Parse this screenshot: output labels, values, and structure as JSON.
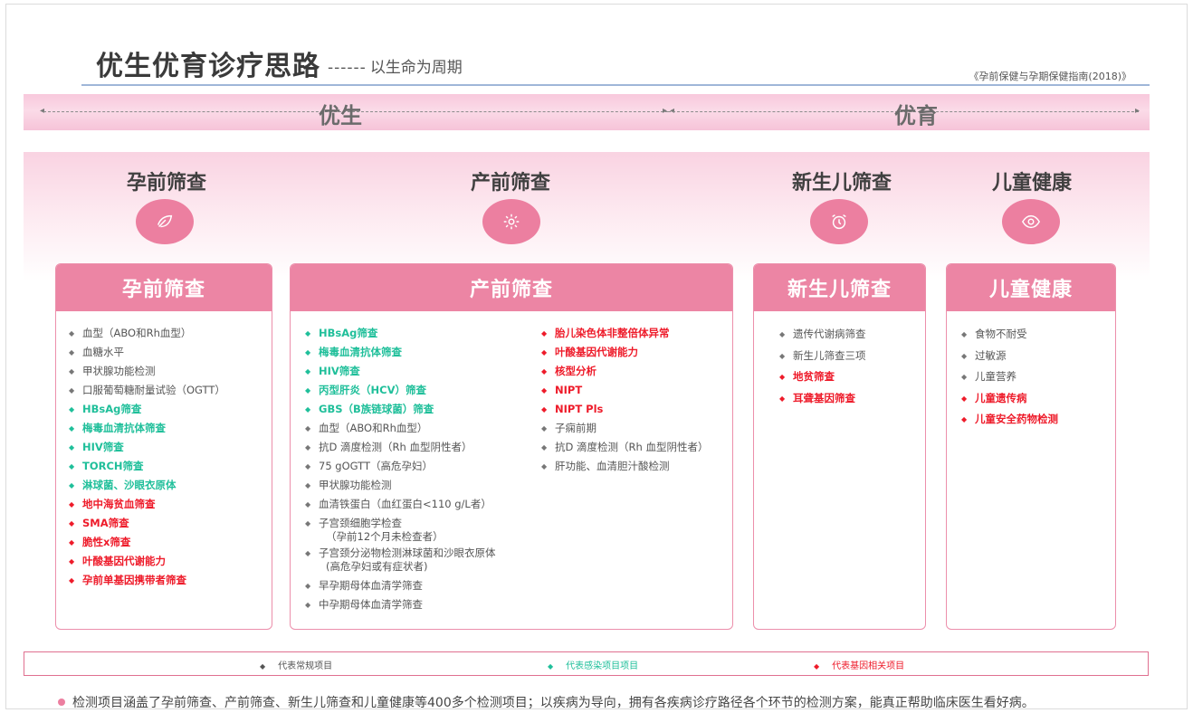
{
  "header": {
    "title": "优生优育诊疗思路",
    "subtitle_dash": "------",
    "subtitle": "以生命为周期",
    "source": "《孕前保健与孕期保健指南(2018)》"
  },
  "band": {
    "left_label": "优生",
    "right_label": "优育"
  },
  "categories": [
    {
      "title": "孕前筛查",
      "icon": "leaf-icon"
    },
    {
      "title": "产前筛查",
      "icon": "gear-icon"
    },
    {
      "title": "新生儿筛查",
      "icon": "alarm-clock-icon"
    },
    {
      "title": "儿童健康",
      "icon": "eye-icon"
    }
  ],
  "cards": {
    "preconception": {
      "title": "孕前筛查",
      "items": [
        {
          "text": "血型（ABO和Rh血型）",
          "type": "normal"
        },
        {
          "text": "血糖水平",
          "type": "normal"
        },
        {
          "text": "甲状腺功能检测",
          "type": "normal"
        },
        {
          "text": "口服葡萄糖耐量试验（OGTT）",
          "type": "normal"
        },
        {
          "text": "HBsAg筛查",
          "type": "infection"
        },
        {
          "text": "梅毒血清抗体筛查",
          "type": "infection"
        },
        {
          "text": "HIV筛查",
          "type": "infection"
        },
        {
          "text": "TORCH筛查",
          "type": "infection"
        },
        {
          "text": "淋球菌、沙眼衣原体",
          "type": "infection"
        },
        {
          "text": "地中海贫血筛查",
          "type": "gene"
        },
        {
          "text": "SMA筛查",
          "type": "gene"
        },
        {
          "text": "脆性x筛查",
          "type": "gene"
        },
        {
          "text": "叶酸基因代谢能力",
          "type": "gene"
        },
        {
          "text": "孕前单基因携带者筛查",
          "type": "gene"
        }
      ]
    },
    "prenatal": {
      "title": "产前筛查",
      "left_items": [
        {
          "text": "HBsAg筛查",
          "type": "infection"
        },
        {
          "text": "梅毒血清抗体筛查",
          "type": "infection"
        },
        {
          "text": "HIV筛查",
          "type": "infection"
        },
        {
          "text": "丙型肝炎（HCV）筛查",
          "type": "infection"
        },
        {
          "text": "GBS（B族链球菌）筛查",
          "type": "infection"
        },
        {
          "text": "血型（ABO和Rh血型）",
          "type": "normal"
        },
        {
          "text": "抗D 滴度检测（Rh 血型阴性者）",
          "type": "normal"
        },
        {
          "text": "75 gOGTT（高危孕妇）",
          "type": "normal"
        },
        {
          "text": "甲状腺功能检测",
          "type": "normal"
        },
        {
          "text": "血清铁蛋白（血红蛋白<110 g/L者）",
          "type": "normal"
        },
        {
          "text": "子宫颈细胞学检查",
          "text2": "（孕前12个月未检查者）",
          "type": "normal"
        },
        {
          "text": "子宫颈分泌物检测淋球菌和沙眼衣原体",
          "text2": "(高危孕妇或有症状者)",
          "type": "normal"
        },
        {
          "text": "早孕期母体血清学筛查",
          "type": "normal"
        },
        {
          "text": "中孕期母体血清学筛查",
          "type": "normal"
        }
      ],
      "right_items": [
        {
          "text": "胎儿染色体非整倍体异常",
          "type": "gene"
        },
        {
          "text": "叶酸基因代谢能力",
          "type": "gene"
        },
        {
          "text": "核型分析",
          "type": "gene"
        },
        {
          "text": "NIPT",
          "type": "gene"
        },
        {
          "text": "NIPT Pls",
          "type": "gene"
        },
        {
          "text": "子痫前期",
          "type": "normal"
        },
        {
          "text": "抗D 滴度检测（Rh 血型阴性者）",
          "type": "normal"
        },
        {
          "text": "肝功能、血清胆汁酸检测",
          "type": "normal"
        }
      ]
    },
    "newborn": {
      "title": "新生儿筛查",
      "items": [
        {
          "text": "遗传代谢病筛查",
          "type": "normal"
        },
        {
          "text": "新生儿筛查三项",
          "type": "normal"
        },
        {
          "text": "地贫筛查",
          "type": "gene"
        },
        {
          "text": "耳聋基因筛查",
          "type": "gene"
        }
      ]
    },
    "child": {
      "title": "儿童健康",
      "items": [
        {
          "text": "食物不耐受",
          "type": "normal"
        },
        {
          "text": "过敏源",
          "type": "normal"
        },
        {
          "text": "儿童营养",
          "type": "normal"
        },
        {
          "text": "儿童遗传病",
          "type": "gene"
        },
        {
          "text": "儿童安全药物检测",
          "type": "gene"
        }
      ]
    }
  },
  "legend": {
    "normal": "代表常规项目",
    "infection": "代表感染项目项目",
    "gene": "代表基因相关项目"
  },
  "footer": "检测项目涵盖了孕前筛查、产前筛查、新生儿筛查和儿童健康等400多个检测项目；以疾病为导向，拥有各疾病诊疗路径各个环节的检测方案，能真正帮助临床医生看好病。",
  "colors": {
    "pink_header": "#ec85a4",
    "infection_green": "#1fbf9a",
    "gene_red": "#ee1b2a",
    "normal_gray": "#555555"
  }
}
